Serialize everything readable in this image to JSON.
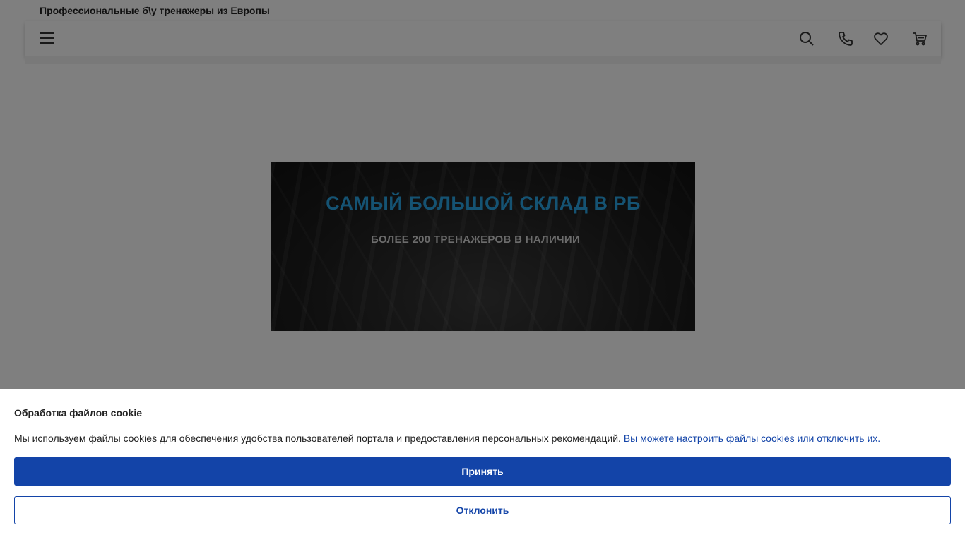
{
  "header": {
    "tagline": "Профессиональные б\\у тренажеры из Европы",
    "icons": [
      "menu-icon",
      "search-icon",
      "phone-icon",
      "heart-icon",
      "cart-icon"
    ]
  },
  "banner": {
    "title": "САМЫЙ БОЛЬШОЙ СКЛАД В РБ",
    "subtitle": "БОЛЕЕ 200 ТРЕНАЖЕРОВ В НАЛИЧИИ"
  },
  "cookie": {
    "title": "Обработка файлов cookie",
    "text": "Мы используем файлы cookies для обеспечения удобства пользователей портала и предоставления персональных рекомендаций.",
    "link": "Вы можете настроить файлы cookies или отключить их.",
    "accept_label": "Принять",
    "decline_label": "Отклонить"
  },
  "colors": {
    "accent": "#1344a8",
    "banner_title": "#2aa7e6",
    "overlay": "rgba(0,0,0,0.5)"
  }
}
